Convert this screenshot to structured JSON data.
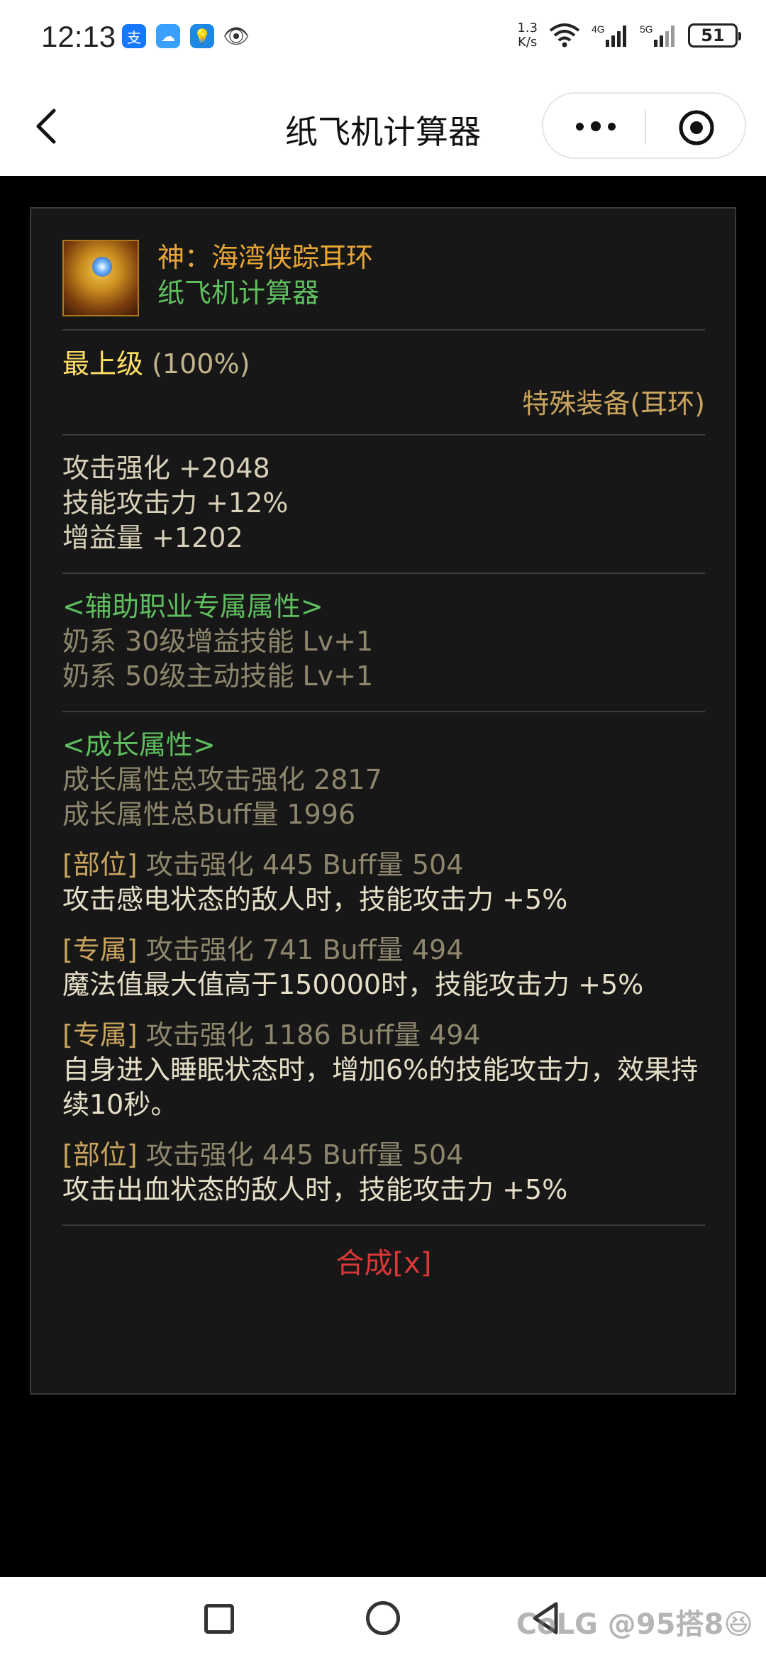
{
  "status_bar": {
    "time": "12:13",
    "net_speed_top": "1.3",
    "net_speed_bottom": "K/s",
    "battery": "51",
    "icons": [
      "alipay-icon",
      "weather-icon",
      "bulb-icon",
      "eye-icon",
      "wifi-icon",
      "signal-4g-icon",
      "signal-5g-icon",
      "battery-icon"
    ]
  },
  "nav": {
    "title": "纸飞机计算器",
    "back_icon": "chevron-left-icon",
    "more_icon": "more-dots-icon",
    "close_icon": "target-circle-icon"
  },
  "item": {
    "name": "神：海湾侠踪耳环",
    "source": "纸飞机计算器",
    "grade": "最上级",
    "grade_pct": "(100%)",
    "type": "特殊装备(耳环)"
  },
  "base_stats": [
    "攻击强化 +2048",
    "技能攻击力 +12%",
    "增益量 +1202"
  ],
  "support_attr": {
    "header": "<辅助职业专属属性>",
    "lines": [
      "奶系 30级增益技能 Lv+1",
      "奶系 50级主动技能 Lv+1"
    ]
  },
  "growth": {
    "header": "<成长属性>",
    "total_attack": "成长属性总攻击强化 2817",
    "total_buff": "成长属性总Buff量 1996",
    "entries": [
      {
        "tag": "[部位]",
        "stats": "攻击强化   445    Buff量   504",
        "effect": "攻击感电状态的敌人时，技能攻击力 +5%"
      },
      {
        "tag": "[专属]",
        "stats": "攻击强化   741    Buff量   494",
        "effect": "魔法值最大值高于150000时，技能攻击力 +5%"
      },
      {
        "tag": "[专属]",
        "stats": "攻击强化   1186    Buff量   494",
        "effect": "自身进入睡眠状态时，增加6%的技能攻击力，效果持续10秒。"
      },
      {
        "tag": "[部位]",
        "stats": "攻击强化   445    Buff量   504",
        "effect": "攻击出血状态的敌人时，技能攻击力 +5%"
      }
    ]
  },
  "synth_label": "合成[x]",
  "watermark": "CoLG @95搭8😆",
  "colors": {
    "item_name": "#e8a634",
    "green": "#5fbf5f",
    "grade": "#ffe066",
    "synth": "#d93838",
    "card_bg": "#171717"
  }
}
